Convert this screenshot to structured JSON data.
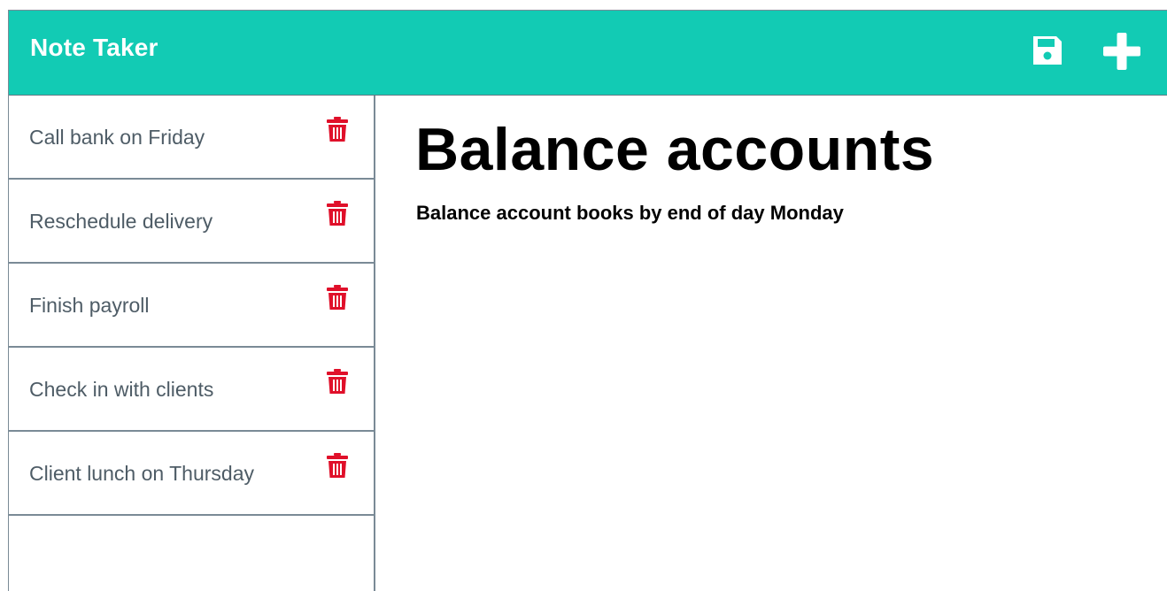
{
  "navbar": {
    "title": "Note Taker",
    "save_icon": "save-icon",
    "add_icon": "plus-icon",
    "background": "#12cbb4"
  },
  "sidebar": {
    "notes": [
      {
        "title": "Call bank on Friday",
        "delete_icon": "trash-icon"
      },
      {
        "title": "Reschedule delivery",
        "delete_icon": "trash-icon"
      },
      {
        "title": "Finish payroll",
        "delete_icon": "trash-icon"
      },
      {
        "title": "Check in with clients",
        "delete_icon": "trash-icon"
      },
      {
        "title": "Client lunch on Thursday",
        "delete_icon": "trash-icon"
      }
    ],
    "delete_color": "#e0102a"
  },
  "active_note": {
    "title": "Balance accounts",
    "text": "Balance account books by end of day Monday"
  }
}
